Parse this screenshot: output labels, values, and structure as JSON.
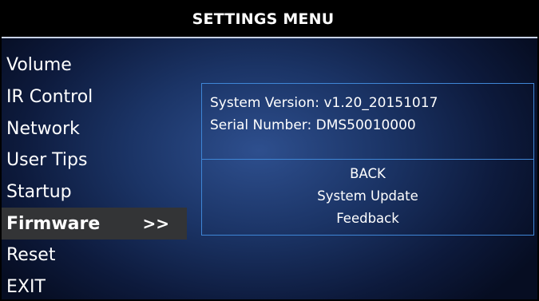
{
  "header": {
    "title": "SETTINGS MENU"
  },
  "menu": {
    "items": [
      {
        "label": "Volume"
      },
      {
        "label": "IR Control"
      },
      {
        "label": "Network"
      },
      {
        "label": "User Tips"
      },
      {
        "label": "Startup"
      },
      {
        "label": "Firmware",
        "selected": true,
        "indicator": ">>"
      },
      {
        "label": "Reset"
      },
      {
        "label": "EXIT"
      }
    ]
  },
  "firmware_panel": {
    "system_version": "System Version:  v1.20_20151017",
    "serial_number": "Serial Number: DMS50010000",
    "actions": [
      "BACK",
      "System Update",
      "Feedback"
    ]
  },
  "colors": {
    "background_center": "#2e4f8e",
    "background_edge": "#060d22",
    "title_bar": "#000000",
    "selected_item": "#333436",
    "panel_border": "#3f86d6",
    "text": "#ffffff"
  }
}
